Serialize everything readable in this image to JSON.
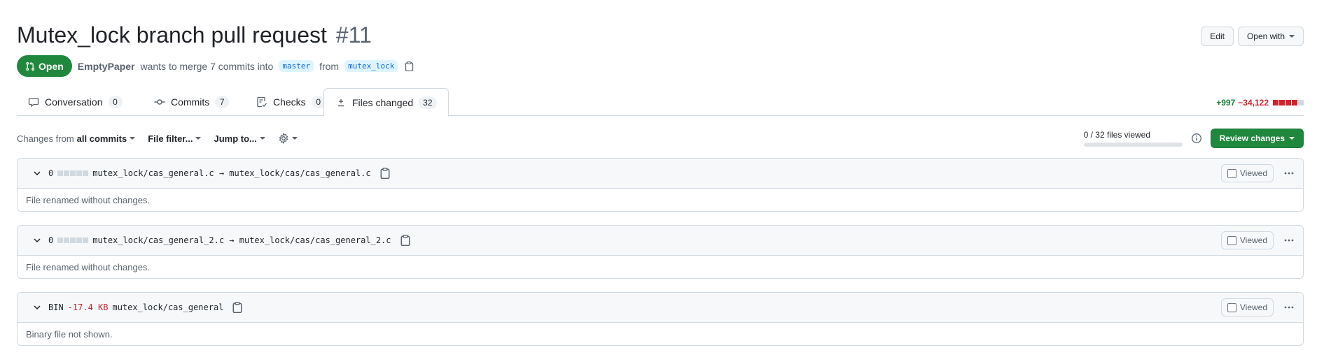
{
  "pr": {
    "title": "Mutex_lock branch pull request",
    "number": "#11",
    "state": "Open",
    "author": "EmptyPaper",
    "merge_text": "wants to merge 7 commits into",
    "base_branch": "master",
    "from_text": "from",
    "head_branch": "mutex_lock"
  },
  "header_actions": {
    "edit_label": "Edit",
    "open_with_label": "Open with"
  },
  "tabs": [
    {
      "label": "Conversation",
      "count": "0",
      "icon": "comment-icon"
    },
    {
      "label": "Commits",
      "count": "7",
      "icon": "commit-icon"
    },
    {
      "label": "Checks",
      "count": "0",
      "icon": "checklist-icon"
    },
    {
      "label": "Files changed",
      "count": "32",
      "icon": "file-diff-icon",
      "selected": true
    }
  ],
  "diffstat": {
    "additions": "+997",
    "deletions": "−34,122",
    "blocks": [
      "#d1242f",
      "#d1242f",
      "#d1242f",
      "#d1242f",
      "#d1d9e0"
    ]
  },
  "toolbar": {
    "changes_from_prefix": "Changes from",
    "changes_from_value": "all commits",
    "file_filter": "File filter...",
    "jump_to": "Jump to...",
    "files_viewed": "0 / 32 files viewed",
    "files_viewed_fraction": 0,
    "review_changes": "Review changes"
  },
  "files": [
    {
      "stat": "0",
      "path": "mutex_lock/cas_general.c → mutex_lock/cas/cas_general.c",
      "body": "File renamed without changes.",
      "viewed_label": "Viewed"
    },
    {
      "stat": "0",
      "path": "mutex_lock/cas_general_2.c → mutex_lock/cas/cas_general_2.c",
      "body": "File renamed without changes.",
      "viewed_label": "Viewed"
    },
    {
      "stat_prefix": "BIN",
      "stat": "-17.4 KB",
      "path": "mutex_lock/cas_general",
      "body": "Binary file not shown.",
      "viewed_label": "Viewed"
    }
  ],
  "colors": {
    "open_green": "#1f883d",
    "addition": "#1a7f37",
    "deletion": "#d1242f",
    "branch_bg": "#ddf4ff",
    "branch_fg": "#0969da"
  }
}
